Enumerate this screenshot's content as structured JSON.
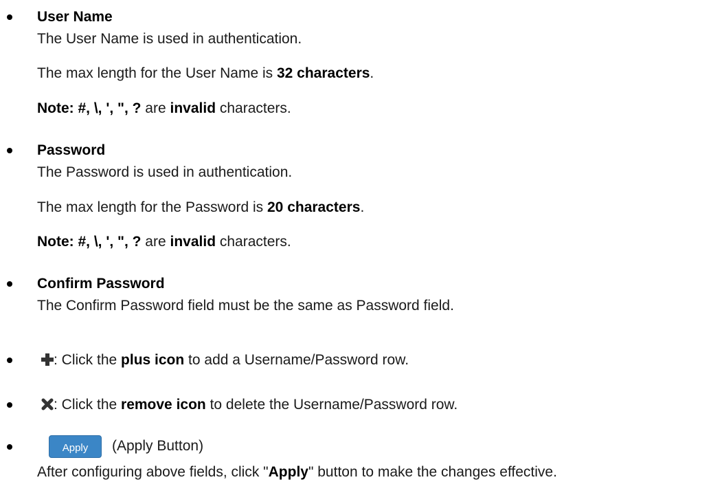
{
  "user_name": {
    "heading": "User Name",
    "desc": "The User Name is used in authentication.",
    "max_prefix": "The max length for the User Name is ",
    "max_value": "32 characters",
    "max_suffix": ".",
    "note_label": "Note: #, \\, ', \", ?",
    "note_mid": " are ",
    "note_invalid": "invalid",
    "note_suffix": " characters."
  },
  "password": {
    "heading": "Password",
    "desc": "The Password is used in authentication.",
    "max_prefix": "The max length for the Password is ",
    "max_value": "20 characters",
    "max_suffix": ".",
    "note_label": "Note: #, \\, ', \", ?",
    "note_mid": " are ",
    "note_invalid": "invalid",
    "note_suffix": " characters."
  },
  "confirm_password": {
    "heading": "Confirm Password",
    "desc": "The Confirm Password field must be the same as Password field."
  },
  "plus": {
    "icon": "plus-icon",
    "prefix": ": Click the ",
    "bold": "plus icon",
    "suffix": " to add a Username/Password row."
  },
  "remove": {
    "icon": "remove-icon",
    "prefix": ": Click the ",
    "bold": "remove icon",
    "suffix": " to delete the Username/Password row."
  },
  "apply": {
    "button_label": "Apply",
    "caption": "(Apply Button)",
    "desc_prefix": "After configuring above fields, click \"",
    "desc_bold": "Apply",
    "desc_suffix": "\" button to make the changes effective.",
    "button_color": "#3b86c6"
  }
}
